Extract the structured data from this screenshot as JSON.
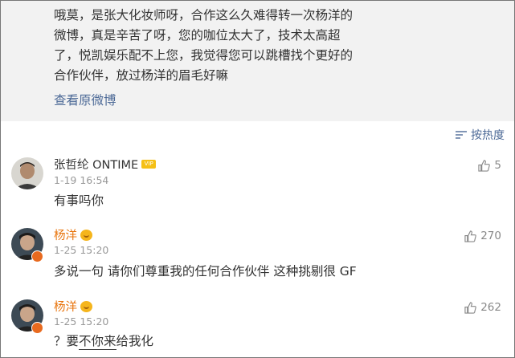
{
  "quote": {
    "lines": [
      "哦莫，是张大化妆师呀，合作这么久难得转一次杨洋的",
      "微博，真是辛苦了呀，您的咖位太大了，技术太高超",
      "了，悦凯娱乐配不上您，我觉得您可以跳槽找个更好的",
      "合作伙伴，放过杨洋的眉毛好嘛"
    ],
    "view_original": "查看原微博"
  },
  "sort": {
    "label": "按热度",
    "icon": "sort-icon"
  },
  "comments": [
    {
      "author": "张哲纶 ONTIME",
      "badge": "member-icon",
      "time": "1-19 16:54",
      "text": "有事吗你",
      "likes": "5"
    },
    {
      "author": "杨洋",
      "badge": "crown-icon",
      "time": "1-25 15:20",
      "text": "多说一句 请你们尊重我的任何合作伙伴 这种挑剔很 GF",
      "likes": "270"
    },
    {
      "author": "杨洋",
      "badge": "crown-icon",
      "time": "1-25 15:20",
      "text_pre": "？要",
      "text_mid": "不你来",
      "text_post": "给我化",
      "likes": "262"
    }
  ],
  "colors": {
    "link": "#4d6a97",
    "vip_name": "#e8740c",
    "quote_bg": "#f2f2f2"
  }
}
